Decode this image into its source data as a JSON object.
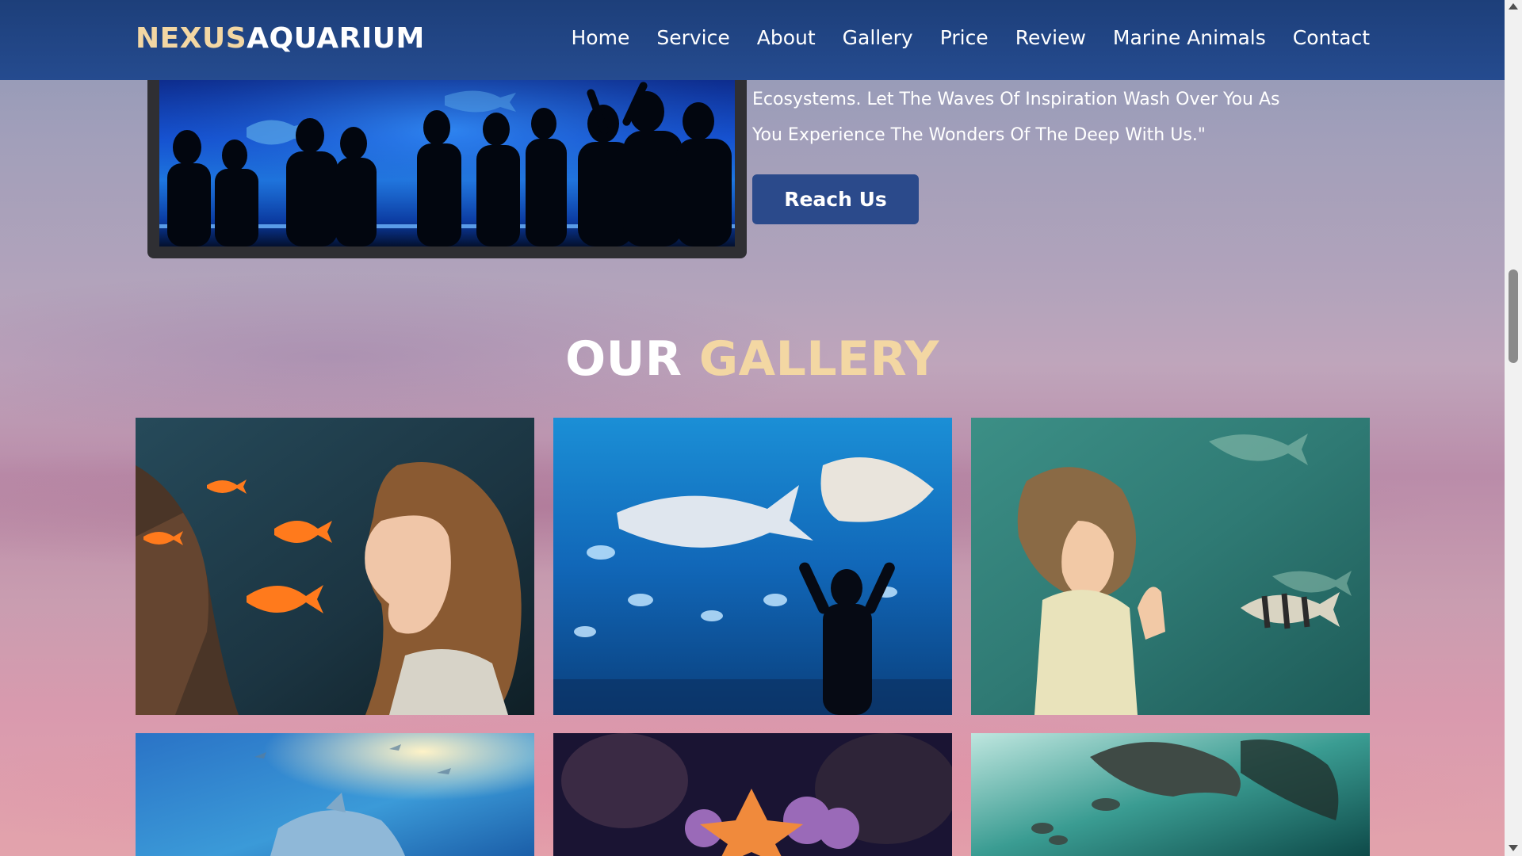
{
  "header": {
    "logo_part1": "NEXUS",
    "logo_part2": "AQUARIUM",
    "nav": [
      "Home",
      "Service",
      "About",
      "Gallery",
      "Price",
      "Review",
      "Marine Animals",
      "Contact"
    ]
  },
  "hero": {
    "text_line1": "Ecosystems. Let The Waves Of Inspiration Wash Over You As",
    "text_line2": "You Experience The Wonders Of The Deep With Us.\"",
    "button_label": "Reach Us"
  },
  "gallery": {
    "title_part1": "OUR",
    "title_part2": "GALLERY"
  },
  "colors": {
    "header_bg": "#1d3f7a",
    "accent_gold": "#f3d7a3",
    "button_bg": "#2b4a8b"
  }
}
